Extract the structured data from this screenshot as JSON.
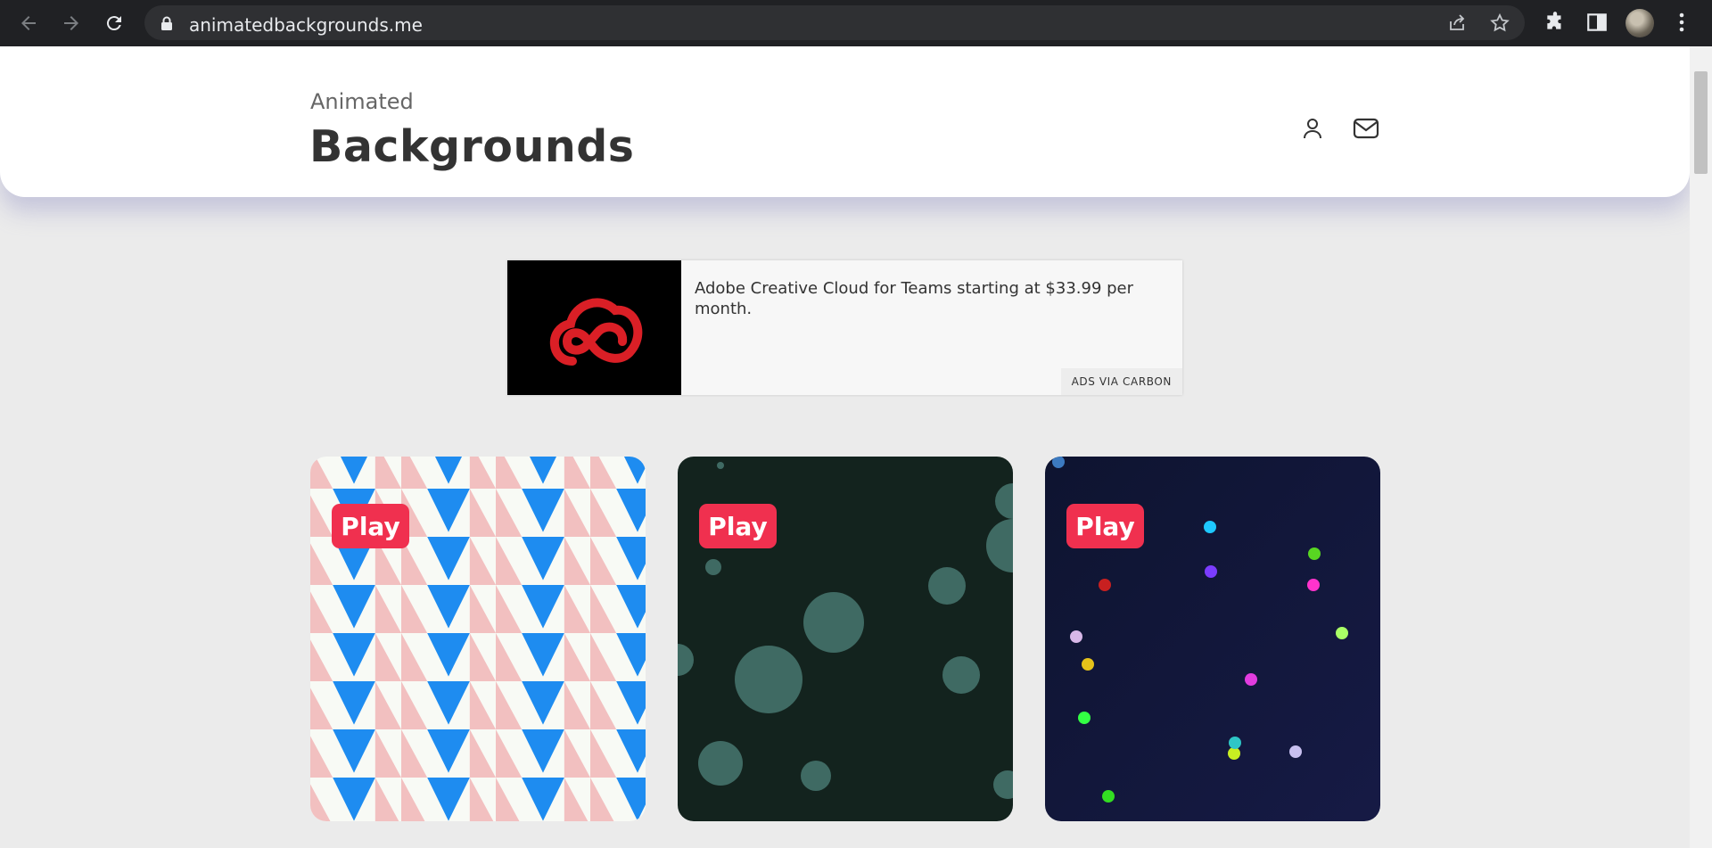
{
  "browser": {
    "url": "animatedbackgrounds.me",
    "icons": [
      "back-icon",
      "forward-icon",
      "reload-icon",
      "lock-icon",
      "share-icon",
      "star-icon",
      "extensions-icon",
      "side-panel-icon",
      "profile-avatar",
      "menu-icon"
    ]
  },
  "header": {
    "brand_small": "Animated",
    "brand_big": "Backgrounds",
    "icons": [
      "user-icon",
      "mail-icon"
    ]
  },
  "ad": {
    "text": "Adobe Creative Cloud for Teams starting at $33.99 per month.",
    "via": "ADS VIA CARBON",
    "logo_color": "#da1f26"
  },
  "cards": [
    {
      "play_label": "Play",
      "theme": "triangle-zigzag",
      "colors": [
        "#f8faf5",
        "#f2c0c0",
        "#1e8cf0"
      ]
    },
    {
      "play_label": "Play",
      "theme": "floating-bubbles",
      "colors": [
        "#13231e",
        "#3f6a63"
      ]
    },
    {
      "play_label": "Play",
      "theme": "colored-dots",
      "colors": [
        "#111637",
        "#1ec8ff",
        "#7b3cff",
        "#58d622",
        "#ff33cc"
      ]
    }
  ],
  "colors": {
    "play_button": "#f0304f",
    "page_bg": "#ebebeb"
  }
}
